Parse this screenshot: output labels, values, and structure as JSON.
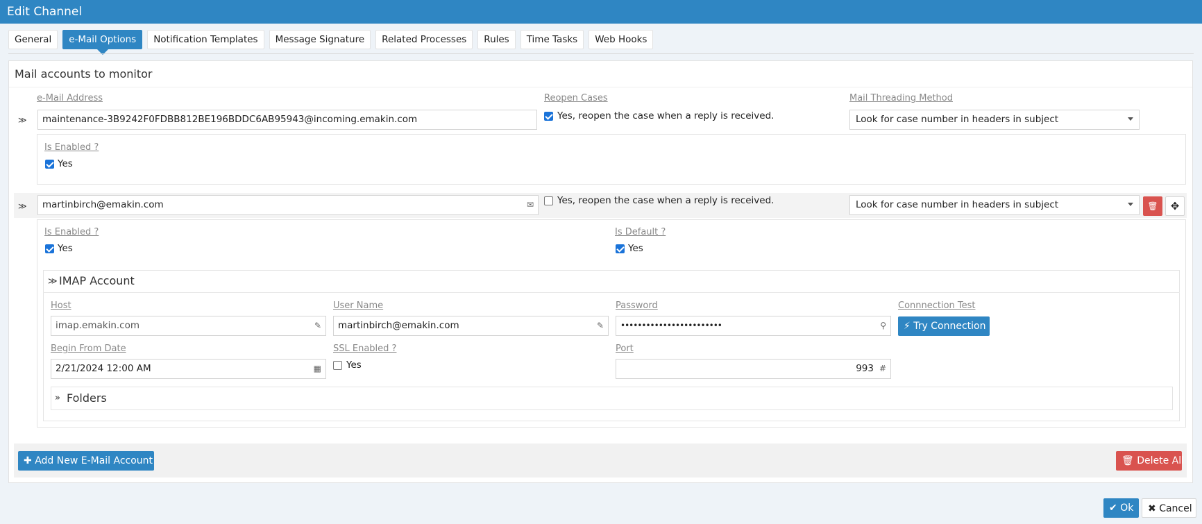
{
  "window": {
    "title": "Edit Channel"
  },
  "tabs": [
    {
      "label": "General"
    },
    {
      "label": "e-Mail Options"
    },
    {
      "label": "Notification Templates"
    },
    {
      "label": "Message Signature"
    },
    {
      "label": "Related Processes"
    },
    {
      "label": "Rules"
    },
    {
      "label": "Time Tasks"
    },
    {
      "label": "Web Hooks"
    }
  ],
  "section": {
    "title": "Mail accounts to monitor"
  },
  "columns": {
    "email": "e-Mail Address",
    "reopen": "Reopen Cases",
    "threading": "Mail Threading Method"
  },
  "accounts": [
    {
      "email": "maintenance-3B9242F0FDBB812BE196BDDC6AB95943@incoming.emakin.com",
      "reopen_label": "Yes, reopen the case when a reply is received.",
      "reopen_checked": true,
      "threading": "Look for case number in headers in subject",
      "enabled_label": "Is Enabled ?",
      "enabled_value": "Yes"
    },
    {
      "email": "martinbirch@emakin.com",
      "reopen_label": "Yes, reopen the case when a reply is received.",
      "reopen_checked": false,
      "threading": "Look for case number in headers in subject",
      "enabled_label": "Is Enabled ?",
      "enabled_value": "Yes",
      "default_label": "Is Default ?",
      "default_value": "Yes",
      "imap": {
        "title": "IMAP Account",
        "host_label": "Host",
        "host_value": "imap.emakin.com",
        "user_label": "User Name",
        "user_value": "martinbirch@emakin.com",
        "password_label": "Password",
        "password_value": "••••••••••••••••••••••••",
        "test_label": "Connnection Test",
        "test_button": "Try Connection",
        "begin_label": "Begin From Date",
        "begin_value": "2/21/2024 12:00 AM",
        "ssl_label": "SSL Enabled ?",
        "ssl_value": "Yes",
        "port_label": "Port",
        "port_value": "993",
        "folders_title": "Folders"
      }
    }
  ],
  "buttons": {
    "add": "Add New E-Mail Account",
    "delete_all": "Delete All",
    "ok": "Ok",
    "cancel": "Cancel"
  },
  "colors": {
    "primary": "#2f86c3",
    "danger": "#d9534f",
    "checkbox": "#1a73d9"
  }
}
